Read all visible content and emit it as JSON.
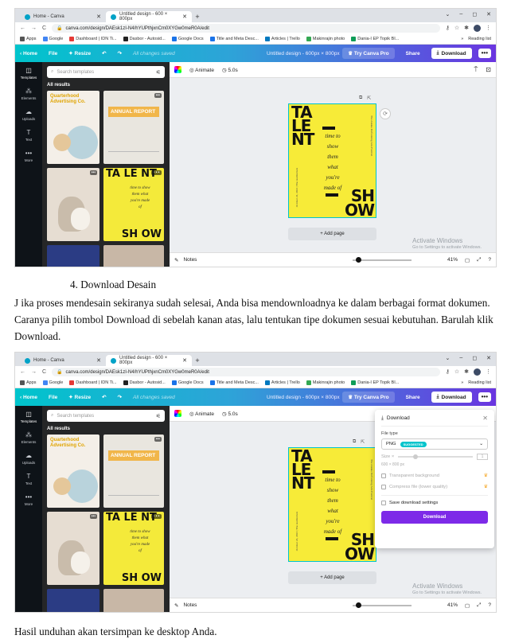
{
  "browser": {
    "tabs": [
      {
        "label": "Home - Canva"
      },
      {
        "label": "Untitled design - 600 × 800px"
      }
    ],
    "new_tab": "+",
    "url": "canva.com/design/DAEsk1zI-N4/hYUPthjxnCm0XYGw0meR0A/edit",
    "bookmarks": [
      "Apps",
      "Google",
      "Dashboard | IDN Ti...",
      "Dasbor - Autosid...",
      "Google Docs",
      "Title and Meta Desc...",
      "Articles | Trello",
      "Makinrajin photo",
      "Dania-I EP Topik BI..."
    ],
    "reading_list": "Reading list",
    "window_controls": [
      "⌄",
      "–",
      "◻",
      "✕"
    ]
  },
  "canva": {
    "home": "Home",
    "file": "File",
    "resize": "Resize",
    "saved_status": "All changes saved",
    "doc_title": "Untitled design - 600px × 800px",
    "try_pro": "Try Canva Pro",
    "share": "Share",
    "download": "Download",
    "more": "•••",
    "nav": [
      "Templates",
      "Elements",
      "Uploads",
      "Text",
      "More"
    ],
    "nav_icons": [
      "templates-icon",
      "elements-icon",
      "uploads-icon",
      "text-icon",
      "more-icon"
    ],
    "search_placeholder": "Search templates",
    "all_results": "All results",
    "template_texts": {
      "quarterly": "Quarterhood Advertising Co.",
      "annual": "ANNUAL REPORT",
      "talent": "TA LE NT",
      "show": "SH OW",
      "poem": "time to show them what you're made of",
      "bottom_label": "Stress Tor WHLB"
    },
    "animate": "Animate",
    "duration": "5.0s",
    "design": {
      "talent": "TA\nLE\nNT",
      "poem": "time to\nshow\nthem\nwhat\nyou're\nmade of",
      "show": "SH\nOW",
      "side_text": "The Alaska Performing Arts Festival",
      "side_text2": "October 21, 2021 | The Auditorium"
    },
    "add_page": "+ Add page",
    "notes": "Notes",
    "zoom": "41%",
    "activate_title": "Activate Windows",
    "activate_sub": "Go to Settings to activate Windows."
  },
  "download_panel": {
    "title": "Download",
    "file_type_label": "File type",
    "file_type": "PNG",
    "badge": "SUGGESTED",
    "size_label": "Size ×",
    "size_value": "1",
    "dims": "600 × 800 px",
    "options": [
      "Transparent background",
      "Compress file (lower quality)"
    ],
    "save_settings": "Save download settings",
    "button": "Download"
  },
  "document": {
    "step": "4.   Download Desain",
    "para1": "J ika proses mendesain sekiranya sudah selesai, Anda bisa mendownloadnya ke dalam berbagai format dokumen. Caranya pilih tombol Download di sebelah kanan atas, lalu tentukan tipe dokumen sesuai kebutuhan. Barulah klik Download.",
    "para2": "Hasil unduhan akan tersimpan ke desktop Anda."
  },
  "colors": {
    "canva_gradient_start": "#00c4cc",
    "canva_gradient_end": "#6a35e0",
    "design_yellow": "#f7eb38",
    "download_button": "#7d2ae8"
  }
}
